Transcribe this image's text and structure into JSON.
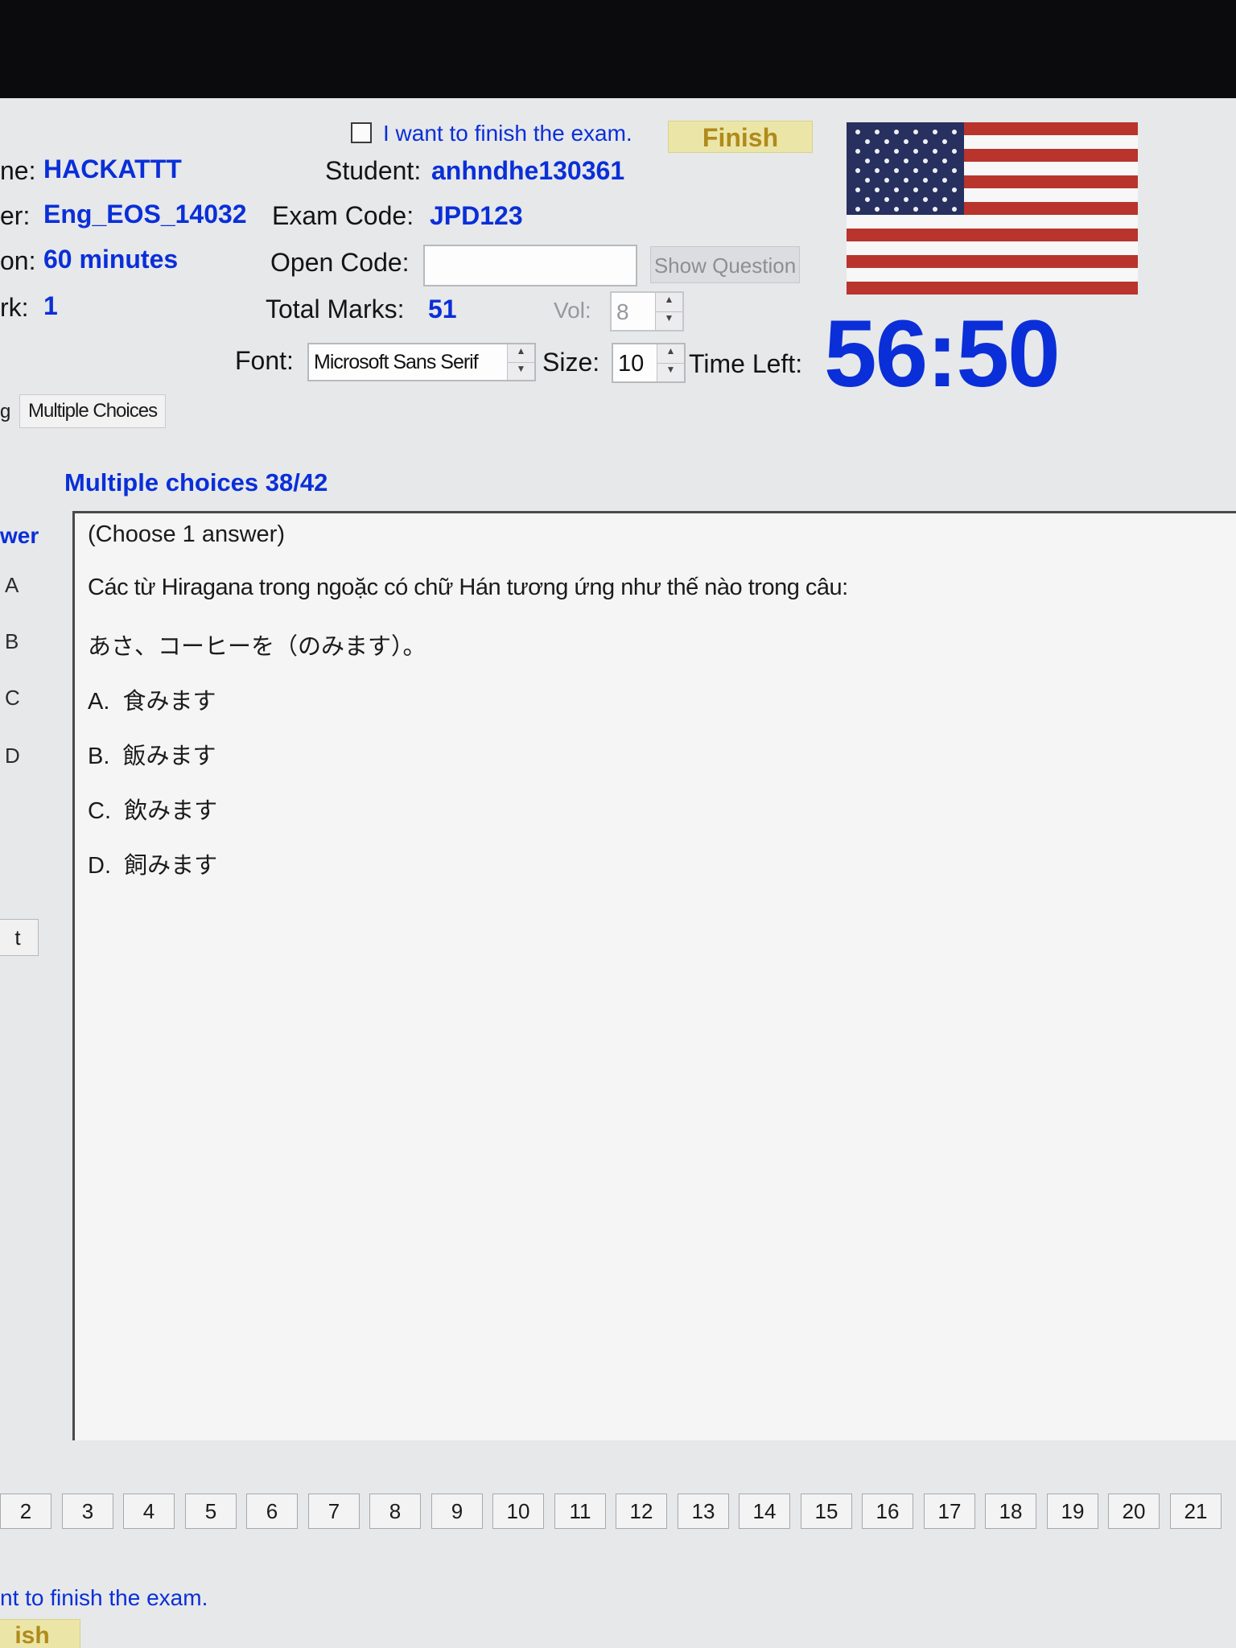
{
  "header": {
    "finish_checkbox_label": "I want to finish the exam.",
    "finish_button": "Finish",
    "name_label": "ne:",
    "name_value": "HACKATTT",
    "student_label": "Student:",
    "student_value": "anhndhe130361",
    "paper_label": "er:",
    "paper_value": "Eng_EOS_14032",
    "exam_code_label": "Exam Code:",
    "exam_code_value": "JPD123",
    "duration_label": "on:",
    "duration_value": "60 minutes",
    "open_code_label": "Open Code:",
    "open_code_value": "",
    "show_question_button": "Show Question",
    "mark_label": "rk:",
    "mark_value": "1",
    "total_marks_label": "Total Marks:",
    "total_marks_value": "51",
    "vol_label": "Vol:",
    "vol_value": "8",
    "font_label": "Font:",
    "font_value": "Microsoft Sans Serif",
    "size_label": "Size:",
    "size_value": "10",
    "time_left_label": "Time Left:",
    "time_left_value": "56:50",
    "flag_icon": "us-flag-icon"
  },
  "tabs": {
    "left_fragment": "g",
    "active_tab": "Multiple Choices"
  },
  "question": {
    "section_title": "Multiple choices 38/42",
    "answer_header": "wer",
    "answer_options": [
      "A",
      "B",
      "C",
      "D"
    ],
    "side_button": "t",
    "instruction": "(Choose 1 answer)",
    "prompt": "Các từ Hiragana trong ngoặc có chữ Hán tương ứng như thế nào trong câu:",
    "sentence": "あさ、コーヒーを（のみます）。",
    "choices": [
      "A.  食みます",
      "B.  飯みます",
      "C.  飲みます",
      "D.  飼みます"
    ]
  },
  "navigation": {
    "numbers": [
      "2",
      "3",
      "4",
      "5",
      "6",
      "7",
      "8",
      "9",
      "10",
      "11",
      "12",
      "13",
      "14",
      "15",
      "16",
      "17",
      "18",
      "19",
      "20",
      "21"
    ]
  },
  "footer": {
    "finish_text": "nt to finish the exam.",
    "finish_button": "ish"
  },
  "colors": {
    "accent": "#0a2fd8",
    "finish_button_bg": "#ebe6a8",
    "panel_bg": "#f5f5f5",
    "window_bg": "#e7e8ea"
  }
}
